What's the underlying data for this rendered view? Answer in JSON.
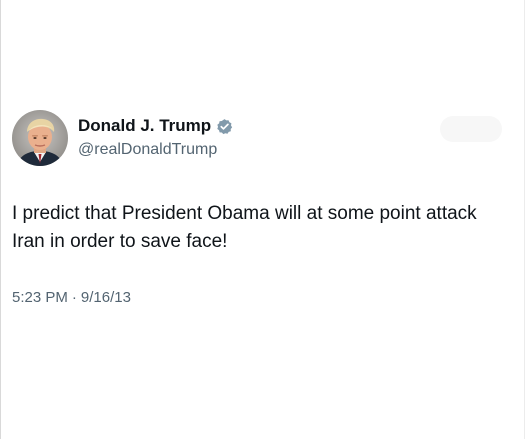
{
  "author": {
    "display_name": "Donald J. Trump",
    "handle": "@realDonaldTrump",
    "verified_icon": "verified-badge-icon",
    "verified_color": "#829aab"
  },
  "tweet": {
    "text": "I predict that President Obama will at some point attack Iran in order to save face!",
    "time": "5:23 PM",
    "separator": "·",
    "date": "9/16/13"
  },
  "colors": {
    "text_primary": "#0f1419",
    "text_secondary": "#536471",
    "background": "#ffffff"
  }
}
